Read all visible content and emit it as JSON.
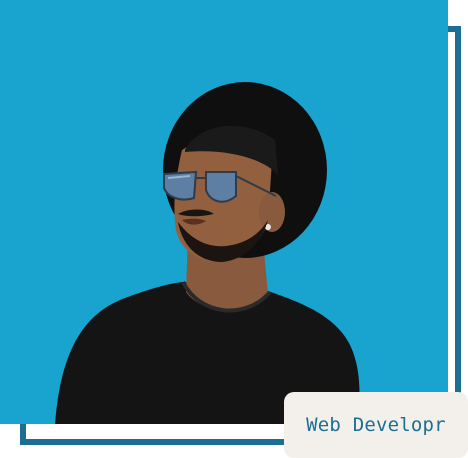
{
  "profile": {
    "role_label": "Web Developr",
    "photo_subject": "portrait-man-hat-sunglasses"
  },
  "colors": {
    "background": "#18a4cf",
    "frame": "#1a6f92",
    "badge_bg": "#f3f0ec",
    "badge_text": "#1a6f92"
  }
}
